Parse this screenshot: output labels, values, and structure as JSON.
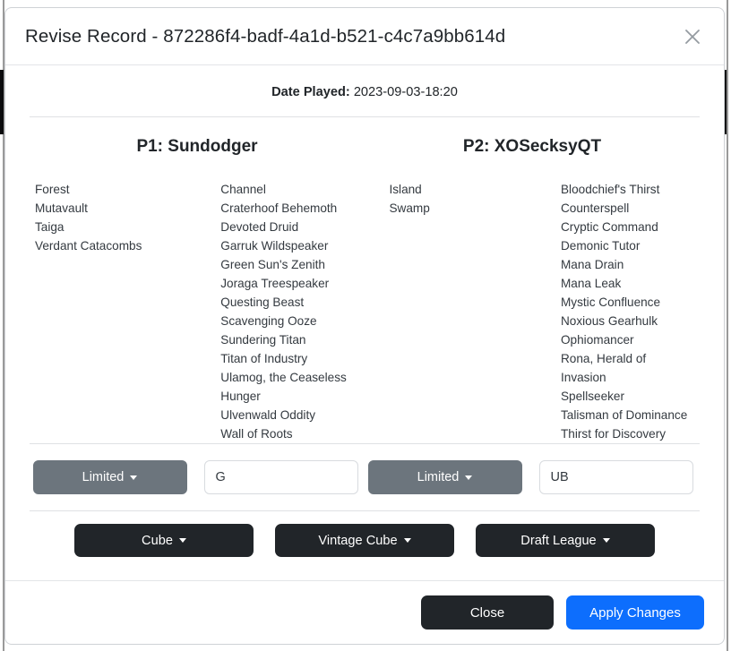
{
  "modal": {
    "title": "Revise Record - 872286f4-badf-4a1d-b521-c4c7a9bb614d",
    "close_icon": "close-icon"
  },
  "date": {
    "label": "Date Played:",
    "value": "2023-09-03-18:20"
  },
  "players": [
    {
      "heading": "P1: Sundodger",
      "lands": [
        "Forest",
        "Mutavault",
        "Taiga",
        "Verdant Catacombs"
      ],
      "spells": [
        "Channel",
        "Craterhoof Behemoth",
        "Devoted Druid",
        "Garruk Wildspeaker",
        "Green Sun's Zenith",
        "Joraga Treespeaker",
        "Questing Beast",
        "Scavenging Ooze",
        "Sundering Titan",
        "Titan of Industry",
        "Ulamog, the Ceaseless Hunger",
        "Ulvenwald Oddity",
        "Wall of Roots"
      ],
      "format_select": "Limited",
      "colors_value": "G"
    },
    {
      "heading": "P2: XOSecksyQT",
      "lands": [
        "Island",
        "Swamp"
      ],
      "spells": [
        "Bloodchief's Thirst",
        "Counterspell",
        "Cryptic Command",
        "Demonic Tutor",
        "Mana Drain",
        "Mana Leak",
        "Mystic Confluence",
        "Noxious Gearhulk",
        "Ophiomancer",
        "Rona, Herald of Invasion",
        "Spellseeker",
        "Talisman of Dominance",
        "Thirst for Discovery"
      ],
      "format_select": "Limited",
      "colors_value": "UB"
    }
  ],
  "category_buttons": [
    {
      "label": "Cube"
    },
    {
      "label": "Vintage Cube"
    },
    {
      "label": "Draft League"
    }
  ],
  "footer": {
    "close_label": "Close",
    "apply_label": "Apply Changes"
  },
  "colors": {
    "primary": "#0d6efd",
    "dark": "#212529",
    "secondary": "#6c757d",
    "text": "#343a40",
    "border": "#dfe1e4"
  }
}
